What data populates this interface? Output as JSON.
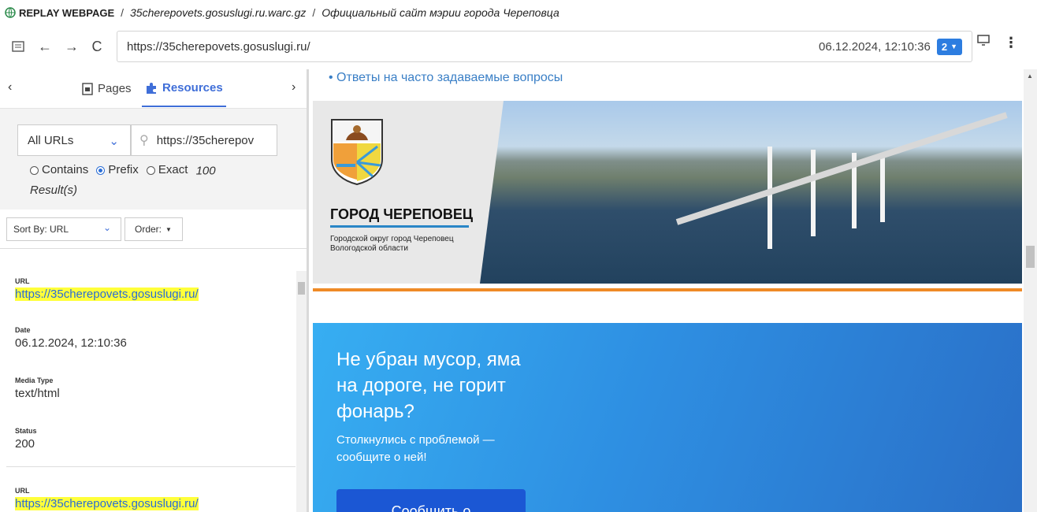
{
  "titlebar": {
    "app_name": "REPLAY WEBPAGE",
    "archive": "35cherepovets.gosuslugi.ru.warc.gz",
    "page_title": "Официальный сайт мэрии города Череповца"
  },
  "navbar": {
    "url": "https://35cherepovets.gosuslugi.ru/",
    "timestamp": "06.12.2024, 12:10:36",
    "capture_count": "2"
  },
  "sidebar": {
    "tabs": {
      "pages": "Pages",
      "resources": "Resources"
    },
    "filter": {
      "url_type": "All URLs",
      "search_value": "https://35cherepov",
      "options": {
        "contains": "Contains",
        "prefix": "Prefix",
        "exact": "Exact"
      },
      "result_count": "100",
      "result_label": "Result(s)"
    },
    "sort": {
      "sort_by": "Sort By: URL",
      "order": "Order:"
    },
    "results": [
      {
        "url_label": "URL",
        "url": "https://35cherepovets.gosuslugi.ru/",
        "date_label": "Date",
        "date": "06.12.2024, 12:10:36",
        "media_label": "Media Type",
        "media": "text/html",
        "status_label": "Status",
        "status": "200"
      },
      {
        "url_label": "URL",
        "url": "https://35cherepovets.gosuslugi.ru/"
      }
    ]
  },
  "content": {
    "faq_link": "Ответы на часто задаваемые вопросы",
    "banner": {
      "city": "ГОРОД ЧЕРЕПОВЕЦ",
      "subtitle": "Городской округ город Череповец Вологодской области"
    },
    "promo": {
      "heading": "Не убран мусор, яма на дороге, не горит фонарь?",
      "text": "Столкнулись с проблемой — сообщите о ней!",
      "button": "Сообщить о"
    }
  },
  "colors": {
    "accent": "#3f6ed8",
    "highlight": "#ffff3a",
    "orange": "#ef8a26",
    "promo_blue": "#2e8fe2"
  }
}
